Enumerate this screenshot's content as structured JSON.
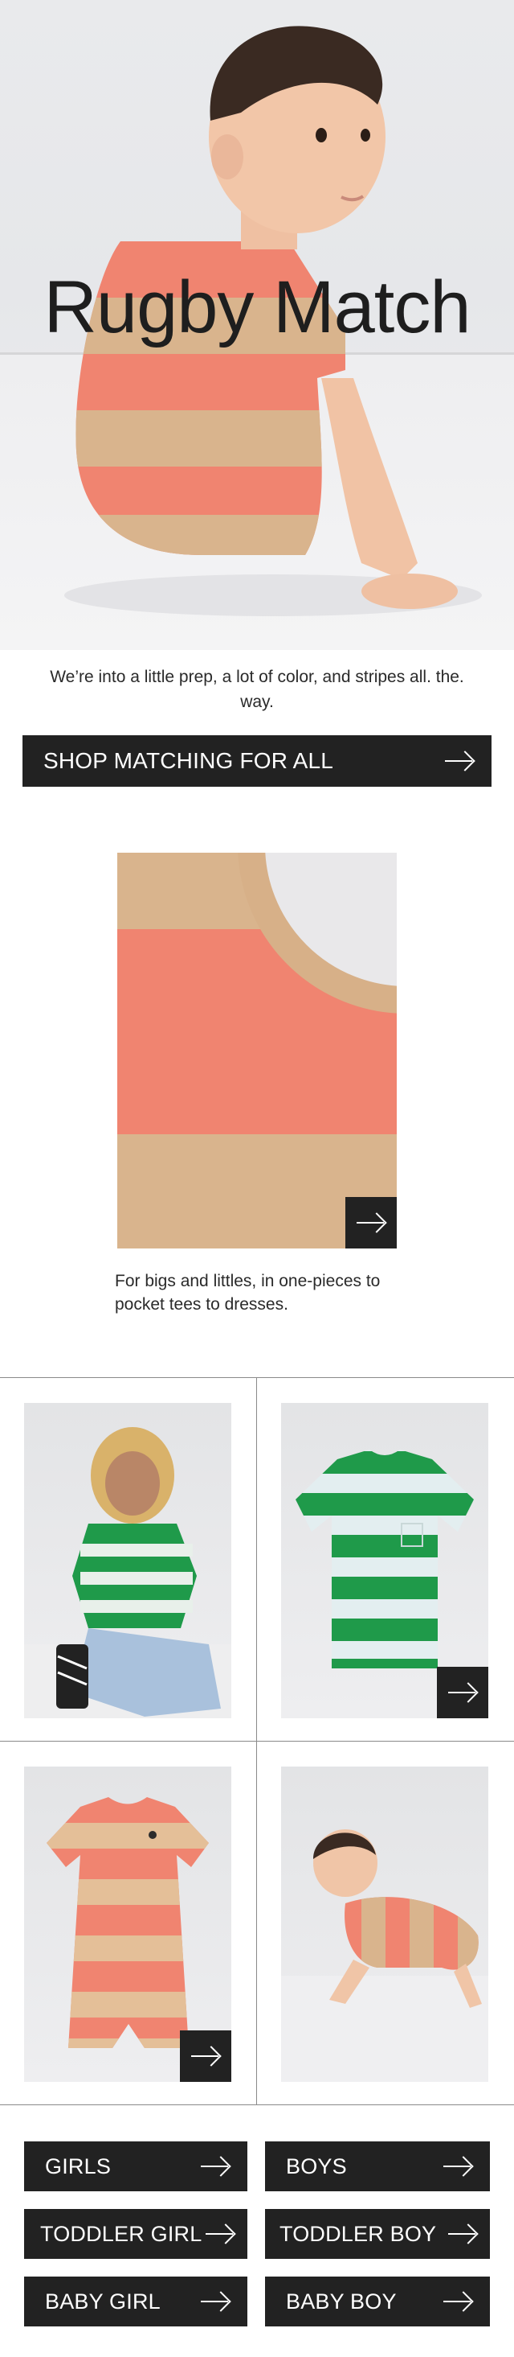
{
  "hero": {
    "title": "Rugby Match",
    "image_desc": "toddler-in-striped-rugby-tee"
  },
  "intro": {
    "text": "We’re into a little prep, a lot of color, and stripes all. the. way.",
    "cta_label": "SHOP MATCHING FOR ALL"
  },
  "detail": {
    "caption": "For bigs and littles, in one-pieces to pocket tees to dresses."
  },
  "categories": [
    {
      "label": "GIRLS"
    },
    {
      "label": "BOYS"
    },
    {
      "label": "TODDLER GIRL"
    },
    {
      "label": "TODDLER BOY"
    },
    {
      "label": "BABY GIRL"
    },
    {
      "label": "BABY BOY"
    }
  ],
  "colors": {
    "coral": "#f08470",
    "tan": "#d9b48d",
    "green": "#1f9a4a",
    "button": "#222222"
  }
}
